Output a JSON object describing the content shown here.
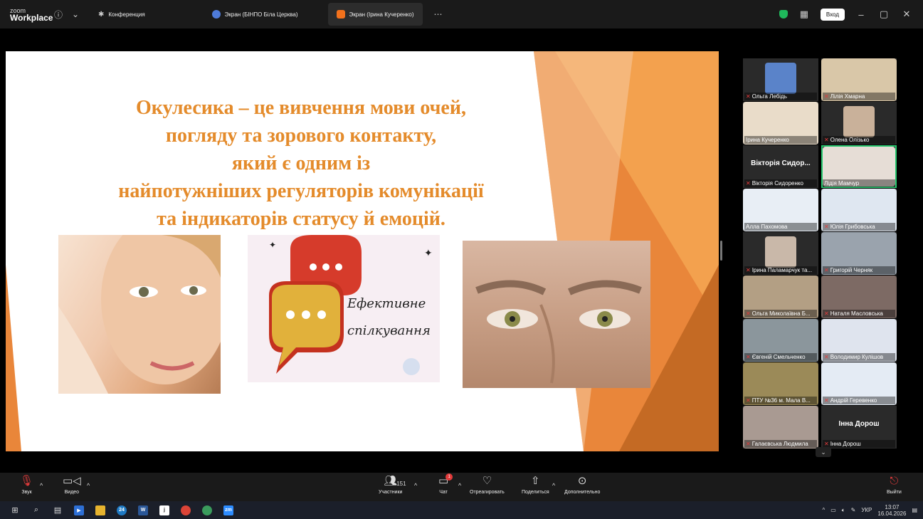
{
  "app": {
    "brand_top": "zoom",
    "brand_bottom": "Workplace"
  },
  "tabs": [
    {
      "label": "Конференция",
      "icon": "meeting-icon",
      "color": "#9aa4b2"
    },
    {
      "label": "Экран (БІНПО Біла Церква)",
      "icon": "screen-share-icon",
      "color": "#4e7bd9"
    },
    {
      "label": "Экран (Ірина Кучеренко)",
      "icon": "screen-share-icon",
      "color": "#f2711c"
    }
  ],
  "window": {
    "login_label": "Вход",
    "minimize": "–",
    "maximize": "▢",
    "close": "✕"
  },
  "slide": {
    "title_lines": [
      "Окулесика – це вивчення мови очей,",
      "погляду та зорового контакту,",
      "який є одним із",
      "найпотужніших регуляторів комунікації",
      "та індикаторів статусу й емоцій."
    ],
    "bubble_text_1": "Ефективне",
    "bubble_text_2": "спілкування",
    "accent_color": "#e48b2b"
  },
  "participants": [
    {
      "name": "Ольга Лебідь",
      "type": "video",
      "color": "#5a83c9"
    },
    {
      "name": "Лілія Хмарна",
      "type": "video",
      "color": "#d9c7a8"
    },
    {
      "name": "Ірина Кучеренко",
      "type": "video",
      "color": "#e9dcc9"
    },
    {
      "name": "Олена Олізько",
      "type": "video",
      "color": "#c9b19a"
    },
    {
      "name": "Вікторія Сидоренко",
      "big_name": "Вікторія Сидор...",
      "type": "name"
    },
    {
      "name": "Лідія Мамчур",
      "type": "video",
      "color": "#e6ddd6",
      "speaking": true
    },
    {
      "name": "Алла Пахомова",
      "type": "video",
      "color": "#e8eef5"
    },
    {
      "name": "Юлія Грибовська",
      "type": "video",
      "color": "#dfe7f1"
    },
    {
      "name": "Ірина Паламарчук та...",
      "type": "video",
      "color": "#c9b8a9"
    },
    {
      "name": "Григорій Черняк",
      "type": "video",
      "color": "#9aa3ad"
    },
    {
      "name": "Ольга Миколаївна Б...",
      "type": "video",
      "color": "#b39f84"
    },
    {
      "name": "Наталя Масловська",
      "type": "video",
      "color": "#7d6a64"
    },
    {
      "name": "Євгеній Смельченко",
      "type": "video",
      "color": "#8b969c"
    },
    {
      "name": "Володимир Кулішов",
      "type": "video",
      "color": "#dfe4ee"
    },
    {
      "name": "ПТУ №36 м. Мала В...",
      "type": "video",
      "color": "#9b8a58"
    },
    {
      "name": "Андрій Геревенко",
      "type": "video",
      "color": "#e4ebf4"
    },
    {
      "name": "Галаєвська Людмила",
      "type": "video",
      "color": "#a99a92"
    },
    {
      "name": "Інна Дорош",
      "big_name": "Інна Дорош",
      "type": "name"
    }
  ],
  "toolbar": {
    "audio": "Звук",
    "video": "Видео",
    "participants": "Участники",
    "participants_count": "151",
    "chat": "Чат",
    "chat_badge": "1",
    "react": "Отреагировать",
    "share": "Поделиться",
    "more": "Дополнительно",
    "leave": "Выйти"
  },
  "taskbar": {
    "lang": "УКР",
    "time": "13:07",
    "date": "16.04.2026",
    "edge_badge": "24"
  }
}
